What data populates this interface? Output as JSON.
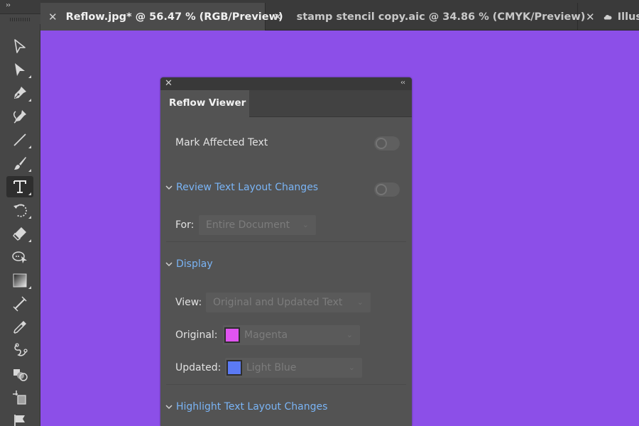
{
  "toolbar": {
    "collapse_icon": "double-chevron-right",
    "tools": [
      {
        "name": "selection-tool",
        "icon": "arrow-outline",
        "has_submenu": false,
        "active": false
      },
      {
        "name": "direct-selection-tool",
        "icon": "arrow-filled",
        "has_submenu": true,
        "active": false
      },
      {
        "name": "pen-tool",
        "icon": "pen",
        "has_submenu": true,
        "active": false
      },
      {
        "name": "curvature-tool",
        "icon": "curvature-pen",
        "has_submenu": false,
        "active": false
      },
      {
        "name": "line-segment-tool",
        "icon": "line",
        "has_submenu": true,
        "active": false
      },
      {
        "name": "paintbrush-tool",
        "icon": "brush",
        "has_submenu": true,
        "active": false
      },
      {
        "name": "type-tool",
        "icon": "type-T",
        "has_submenu": true,
        "active": true
      },
      {
        "name": "rotate-tool",
        "icon": "rotate",
        "has_submenu": true,
        "active": false
      },
      {
        "name": "eraser-tool",
        "icon": "eraser",
        "has_submenu": true,
        "active": false
      },
      {
        "name": "puppet-warp-tool",
        "icon": "warp-select",
        "has_submenu": false,
        "active": false
      },
      {
        "name": "gradient-tool",
        "icon": "gradient",
        "has_submenu": true,
        "active": false
      },
      {
        "name": "measure-tool",
        "icon": "measure",
        "has_submenu": false,
        "active": false
      },
      {
        "name": "eyedropper-tool",
        "icon": "eyedropper",
        "has_submenu": false,
        "active": false
      },
      {
        "name": "blend-tool",
        "icon": "blend",
        "has_submenu": false,
        "active": false
      },
      {
        "name": "shape-builder-tool",
        "icon": "shape-builder",
        "has_submenu": false,
        "active": false
      },
      {
        "name": "artboard-tool",
        "icon": "artboard",
        "has_submenu": false,
        "active": false
      },
      {
        "name": "slice-tool",
        "icon": "slice",
        "has_submenu": false,
        "active": false
      }
    ]
  },
  "tabs": [
    {
      "label": "Reflow.jpg* @ 56.47 % (RGB/Preview)",
      "active": true,
      "cloud": false
    },
    {
      "label": "stamp stencil copy.aic @ 34.86 % (CMYK/Preview)",
      "active": false,
      "cloud": true
    },
    {
      "label": "Illus",
      "active": false,
      "cloud": true
    }
  ],
  "canvas": {
    "background_color": "#8c4fe8"
  },
  "panel": {
    "close_icon": "close-x",
    "collapse_icon": "double-chevron-left",
    "tab_label": "Reflow Viewer",
    "mark_affected_text": {
      "label": "Mark Affected Text",
      "enabled": false
    },
    "review_section": {
      "title": "Review Text Layout Changes",
      "enabled": false,
      "for_label": "For:",
      "for_value": "Entire Document"
    },
    "display_section": {
      "title": "Display",
      "view_label": "View:",
      "view_value": "Original and Updated Text",
      "original_label": "Original:",
      "original_value": "Magenta",
      "original_color": "#e054f0",
      "updated_label": "Updated:",
      "updated_value": "Light Blue",
      "updated_color": "#5b7af5"
    },
    "highlight_section": {
      "title": "Highlight Text Layout Changes"
    }
  }
}
